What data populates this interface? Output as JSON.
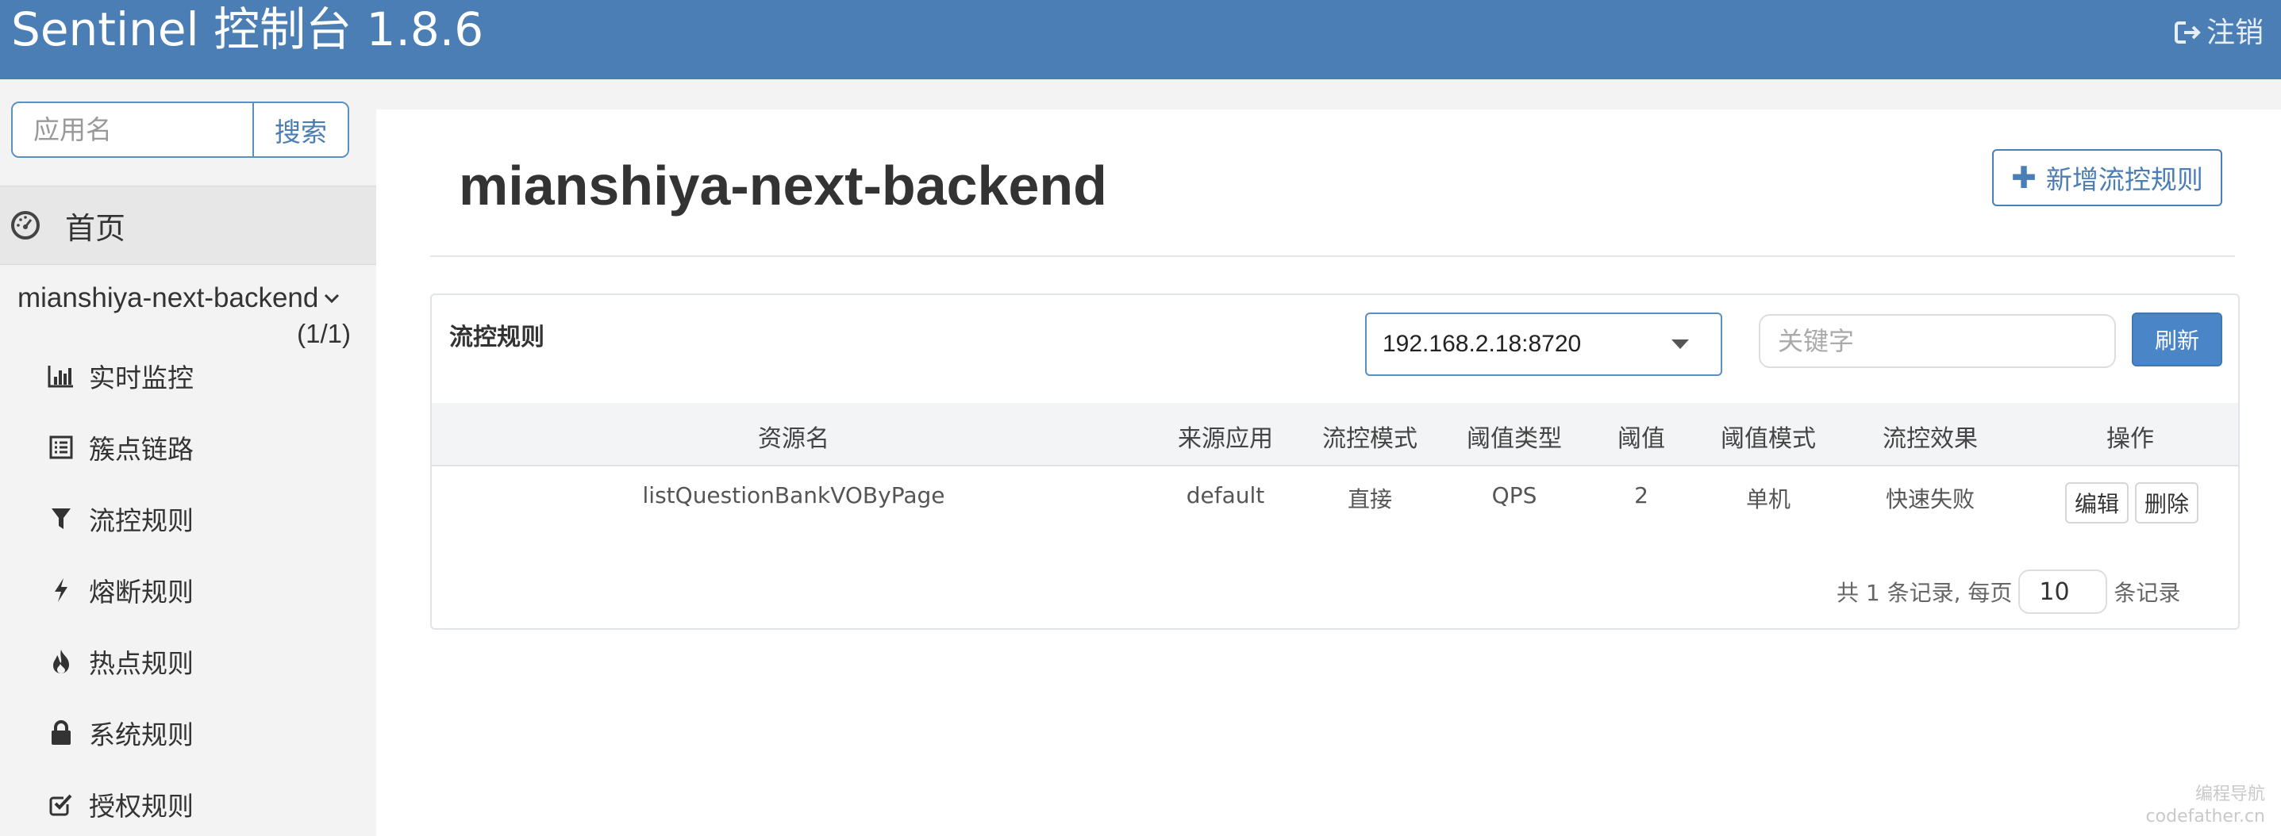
{
  "header": {
    "brand": "Sentinel 控制台 1.8.6",
    "logout_label": "注销"
  },
  "sidebar": {
    "search": {
      "placeholder": "应用名",
      "button_label": "搜索"
    },
    "home_label": "首页",
    "app": {
      "name": "mianshiya-next-backend",
      "count": "(1/1)"
    },
    "items": [
      {
        "label": "实时监控",
        "icon": "bar-chart-icon"
      },
      {
        "label": "簇点链路",
        "icon": "list-icon"
      },
      {
        "label": "流控规则",
        "icon": "filter-icon"
      },
      {
        "label": "熔断规则",
        "icon": "flash-icon"
      },
      {
        "label": "热点规则",
        "icon": "fire-icon"
      },
      {
        "label": "系统规则",
        "icon": "lock-icon"
      },
      {
        "label": "授权规则",
        "icon": "check-square-icon"
      }
    ]
  },
  "main": {
    "title": "mianshiya-next-backend",
    "add_button_label": "新增流控规则",
    "panel": {
      "title": "流控规则",
      "machine_select_value": "192.168.2.18:8720",
      "keyword_placeholder": "关键字",
      "refresh_label": "刷新"
    },
    "table": {
      "headers": [
        "资源名",
        "来源应用",
        "流控模式",
        "阈值类型",
        "阈值",
        "阈值模式",
        "流控效果",
        "操作"
      ],
      "rows": [
        {
          "resource": "listQuestionBankVOByPage",
          "source_app": "default",
          "flow_mode": "直接",
          "threshold_type": "QPS",
          "threshold": "2",
          "threshold_mode": "单机",
          "effect": "快速失败",
          "edit_label": "编辑",
          "delete_label": "删除"
        }
      ]
    },
    "pager": {
      "total_text": "共 1 条记录, 每页",
      "page_size": "10",
      "suffix": "条记录"
    }
  },
  "watermark": {
    "line1": "编程导航",
    "line2": "codefather.cn"
  },
  "colors": {
    "header_bg": "#4a7eb5",
    "accent": "#4a7eb5",
    "refresh_bg": "#4a85c7"
  }
}
